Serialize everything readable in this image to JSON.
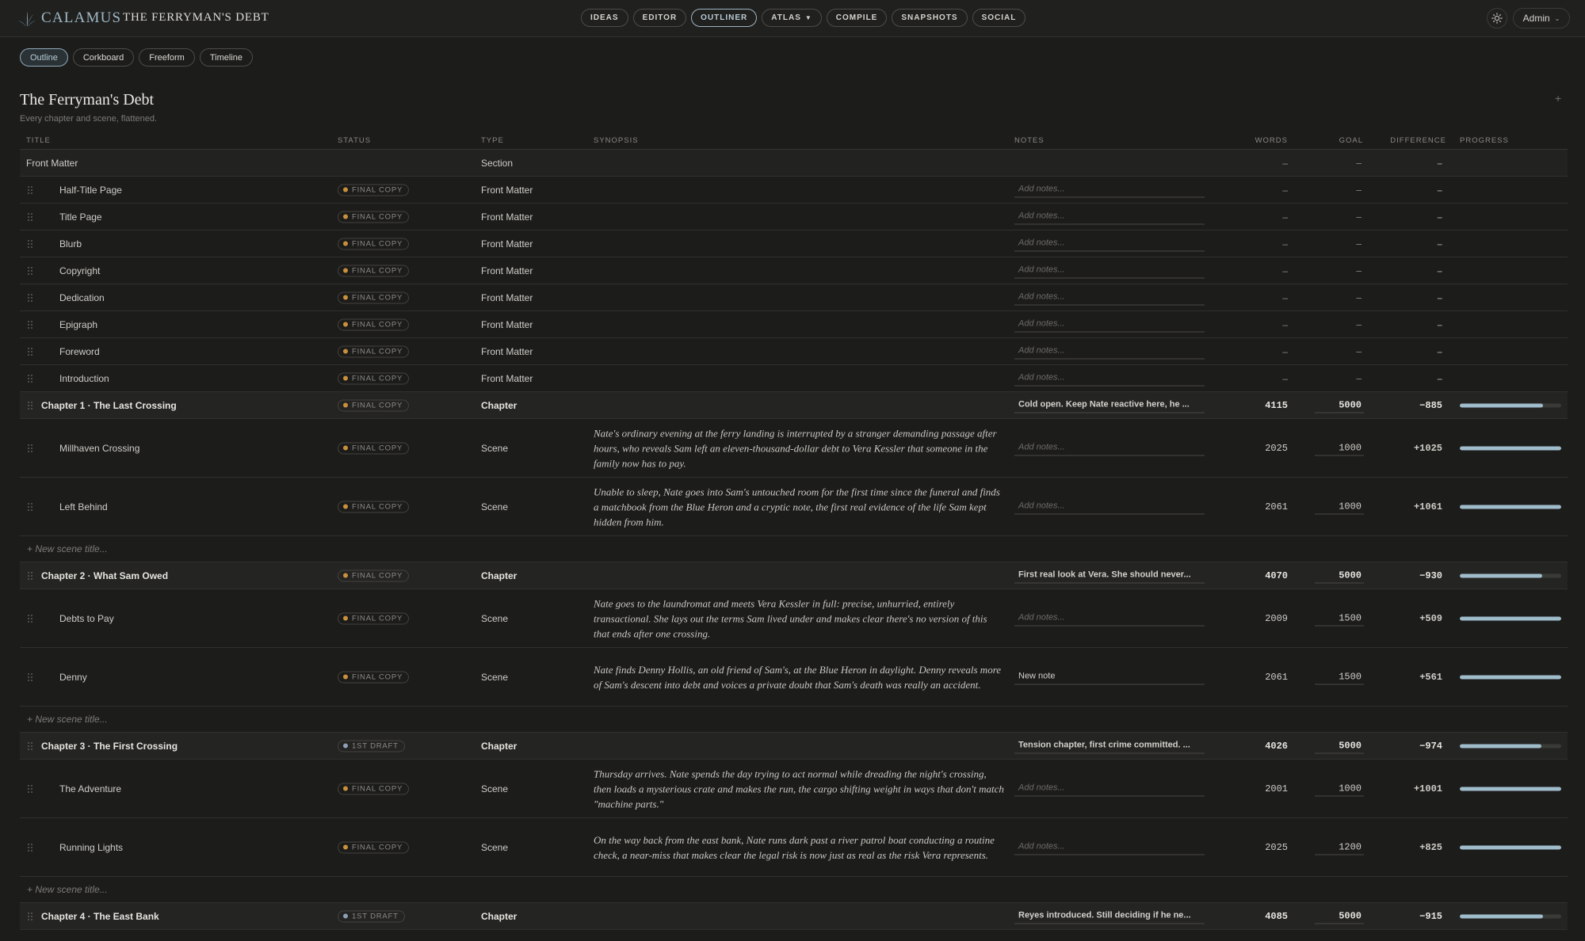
{
  "app": {
    "brand": "CALAMUS",
    "doc_title": "THE FERRYMAN'S DEBT",
    "nav": [
      "IDEAS",
      "EDITOR",
      "OUTLINER",
      "ATLAS",
      "COMPILE",
      "SNAPSHOTS",
      "SOCIAL"
    ],
    "nav_active": "OUTLINER",
    "user": "Admin"
  },
  "views": [
    "Outline",
    "Corkboard",
    "Freeform",
    "Timeline"
  ],
  "view_active": "Outline",
  "page": {
    "title": "The Ferryman's Debt",
    "subtitle": "Every chapter and scene, flattened.",
    "add": "+"
  },
  "columns": {
    "title": "TITLE",
    "status": "STATUS",
    "type": "TYPE",
    "synopsis": "SYNOPSIS",
    "notes": "NOTES",
    "words": "WORDS",
    "goal": "GOAL",
    "difference": "DIFFERENCE",
    "progress": "PROGRESS"
  },
  "notes_placeholder": "Add notes...",
  "new_scene_placeholder": "+ New scene title...",
  "dash": "–",
  "status_colors": {
    "FINAL COPY": "#c9903c",
    "1ST DRAFT": "#8e9fb4"
  },
  "rows": [
    {
      "kind": "section",
      "title": "Front Matter",
      "type": "Section",
      "words": "–",
      "goal": "–",
      "diff": "–"
    },
    {
      "kind": "item",
      "title": "Half-Title Page",
      "status": "FINAL COPY",
      "type": "Front Matter",
      "words": "–",
      "goal": "–",
      "diff": "–"
    },
    {
      "kind": "item",
      "title": "Title Page",
      "status": "FINAL COPY",
      "type": "Front Matter",
      "words": "–",
      "goal": "–",
      "diff": "–"
    },
    {
      "kind": "item",
      "title": "Blurb",
      "status": "FINAL COPY",
      "type": "Front Matter",
      "words": "–",
      "goal": "–",
      "diff": "–"
    },
    {
      "kind": "item",
      "title": "Copyright",
      "status": "FINAL COPY",
      "type": "Front Matter",
      "words": "–",
      "goal": "–",
      "diff": "–"
    },
    {
      "kind": "item",
      "title": "Dedication",
      "status": "FINAL COPY",
      "type": "Front Matter",
      "words": "–",
      "goal": "–",
      "diff": "–"
    },
    {
      "kind": "item",
      "title": "Epigraph",
      "status": "FINAL COPY",
      "type": "Front Matter",
      "words": "–",
      "goal": "–",
      "diff": "–"
    },
    {
      "kind": "item",
      "title": "Foreword",
      "status": "FINAL COPY",
      "type": "Front Matter",
      "words": "–",
      "goal": "–",
      "diff": "–"
    },
    {
      "kind": "item",
      "title": "Introduction",
      "status": "FINAL COPY",
      "type": "Front Matter",
      "words": "–",
      "goal": "–",
      "diff": "–"
    },
    {
      "kind": "chapter",
      "title": "Chapter 1 · The Last Crossing",
      "status": "FINAL COPY",
      "type": "Chapter",
      "notes": "Cold open. Keep Nate reactive here, he ...",
      "words": "4115",
      "goal": "5000",
      "diff": "−885",
      "progress": 0.823
    },
    {
      "kind": "scene",
      "title": "Millhaven Crossing",
      "status": "FINAL COPY",
      "type": "Scene",
      "synopsis": "Nate's ordinary evening at the ferry landing is interrupted by a stranger demanding passage after hours, who reveals Sam left an eleven-thousand-dollar debt to Vera Kessler that someone in the family now has to pay.",
      "words": "2025",
      "goal": "1000",
      "diff": "+1025",
      "progress": 1
    },
    {
      "kind": "scene",
      "title": "Left Behind",
      "status": "FINAL COPY",
      "type": "Scene",
      "synopsis": "Unable to sleep, Nate goes into Sam's untouched room for the first time since the funeral and finds a matchbook from the Blue Heron and a cryptic note, the first real evidence of the life Sam kept hidden from him.",
      "words": "2061",
      "goal": "1000",
      "diff": "+1061",
      "progress": 1
    },
    {
      "kind": "new"
    },
    {
      "kind": "chapter",
      "title": "Chapter 2 · What Sam Owed",
      "status": "FINAL COPY",
      "type": "Chapter",
      "notes": "First real look at Vera. She should never...",
      "words": "4070",
      "goal": "5000",
      "diff": "−930",
      "progress": 0.814
    },
    {
      "kind": "scene",
      "title": "Debts to Pay",
      "status": "FINAL COPY",
      "type": "Scene",
      "synopsis": "Nate goes to the laundromat and meets Vera Kessler in full: precise, unhurried, entirely transactional. She lays out the terms Sam lived under and makes clear there's no version of this that ends after one crossing.",
      "words": "2009",
      "goal": "1500",
      "diff": "+509",
      "progress": 1
    },
    {
      "kind": "scene",
      "title": "Denny",
      "status": "FINAL COPY",
      "type": "Scene",
      "synopsis": "Nate finds Denny Hollis, an old friend of Sam's, at the Blue Heron in daylight. Denny reveals more of Sam's descent into debt and voices a private doubt that Sam's death was really an accident.",
      "notes": "New note",
      "words": "2061",
      "goal": "1500",
      "diff": "+561",
      "progress": 1
    },
    {
      "kind": "new"
    },
    {
      "kind": "chapter",
      "title": "Chapter 3 · The First Crossing",
      "status": "1ST DRAFT",
      "type": "Chapter",
      "notes": "Tension chapter, first crime committed. ...",
      "words": "4026",
      "goal": "5000",
      "diff": "−974",
      "progress": 0.805
    },
    {
      "kind": "scene",
      "title": "The Adventure",
      "status": "FINAL COPY",
      "type": "Scene",
      "synopsis": "Thursday arrives. Nate spends the day trying to act normal while dreading the night's crossing, then loads a mysterious crate and makes the run, the cargo shifting weight in ways that don't match \"machine parts.\"",
      "words": "2001",
      "goal": "1000",
      "diff": "+1001",
      "progress": 1
    },
    {
      "kind": "scene",
      "title": "Running Lights",
      "status": "FINAL COPY",
      "type": "Scene",
      "synopsis": "On the way back from the east bank, Nate runs dark past a river patrol boat conducting a routine check, a near-miss that makes clear the legal risk is now just as real as the risk Vera represents.",
      "words": "2025",
      "goal": "1200",
      "diff": "+825",
      "progress": 1
    },
    {
      "kind": "new"
    },
    {
      "kind": "chapter",
      "title": "Chapter 4 · The East Bank",
      "status": "1ST DRAFT",
      "type": "Chapter",
      "notes": "Reyes introduced. Still deciding if he ne...",
      "words": "4085",
      "goal": "5000",
      "diff": "−915",
      "progress": 0.817
    }
  ]
}
